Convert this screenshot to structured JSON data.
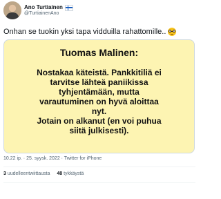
{
  "author": {
    "display_name": "Ano Turtiainen",
    "handle": "@TurtiainenAno",
    "flag_icon": "finland-flag-icon",
    "avatar_icon": "profile-photo"
  },
  "tweet": {
    "text": "Onhan se tuokin yksi tapa vidduilla rahattomille..",
    "emoji": "nerd-face-emoji"
  },
  "card": {
    "background": "#fdf4b2",
    "title": "Tuomas Malinen:",
    "lines": [
      "Nostakaa käteistä. Pankkitiliä ei",
      "tarvitse lähteä paniikissa",
      "tyhjentämään, mutta",
      "varautuminen on hyvä aloittaa",
      "nyt.",
      "Jotain on alkanut (en voi puhua",
      "siitä julkisesti)."
    ]
  },
  "meta": {
    "text": "10.22 ip. · 25. syysk. 2022 · Twitter for iPhone"
  },
  "stats": {
    "retweets_count": "3",
    "retweets_label": "uudelleentwiittausta",
    "likes_count": "48",
    "likes_label": "tykkäystä"
  }
}
